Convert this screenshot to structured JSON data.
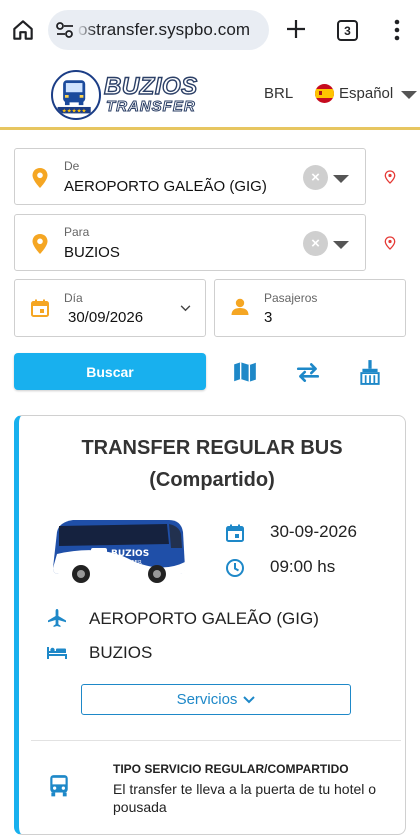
{
  "browser": {
    "url": "ostransfer.syspbo.com",
    "tab_count": "3",
    "icons": [
      "home-icon",
      "site-settings-icon",
      "new-tab-icon",
      "tabs-icon",
      "more-menu-icon"
    ]
  },
  "header": {
    "logo": {
      "line1": "BUZIOS",
      "line2": "TRANSFER"
    },
    "currency": "BRL",
    "language": "Español"
  },
  "search": {
    "from": {
      "label": "De",
      "value": "AEROPORTO GALEÃO (GIG)"
    },
    "to": {
      "label": "Para",
      "value": "BUZIOS"
    },
    "date": {
      "label": "Día",
      "value": "30/09/2026"
    },
    "passengers": {
      "label": "Pasajeros",
      "value": "3"
    },
    "search_button": "Buscar",
    "tools": [
      "map-icon",
      "swap-icon",
      "clear-broom-icon"
    ]
  },
  "result": {
    "title_line1": "TRANSFER REGULAR BUS",
    "title_line2": "(Compartido)",
    "bus_logo": {
      "line1": "BUZIOS",
      "line2": "TRANSFER"
    },
    "date": "30-09-2026",
    "time": "09:00 hs",
    "from": "AEROPORTO GALEÃO (GIG)",
    "to": "BUZIOS",
    "services_button": "Servicios",
    "service_type_title": "TIPO SERVICIO REGULAR/COMPARTIDO",
    "service_type_desc": "El transfer te lleva a la puerta de tu hotel o pousada"
  },
  "colors": {
    "accent": "#18b0ee",
    "pin": "#f5a623",
    "geo_pin": "#e53935",
    "icon_blue": "#1e88c8",
    "header_border": "#e7c660"
  }
}
